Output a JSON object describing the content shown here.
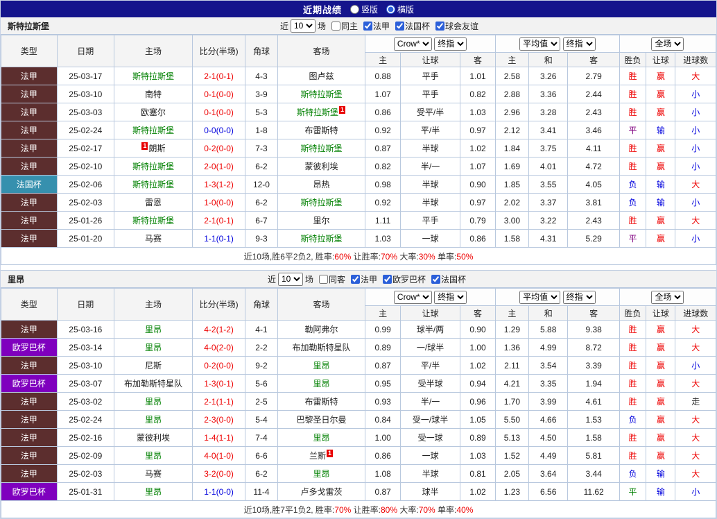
{
  "topbar": {
    "title": "近期战绩",
    "vertical": "竖版",
    "horizontal": "横版",
    "selected": "横版"
  },
  "colors": {
    "navy": "#14148C",
    "border": "#B8C8DE",
    "header_bg": "#F4F4F4",
    "team_focus": "#008000",
    "text": "#222222",
    "codes": {
      "r": "#EE0000",
      "b": "#0000DD",
      "p": "#800080",
      "g": "#008000",
      "k": "#333333"
    },
    "league": {
      "ligue1": "#5C2E2E",
      "coupe": "#3690AE",
      "europa": "#7F00BE"
    }
  },
  "headers": {
    "cols": [
      "类型",
      "日期",
      "主场",
      "比分(半场)",
      "角球",
      "客场"
    ],
    "sub": [
      "主",
      "让球",
      "客",
      "主",
      "和",
      "客",
      "胜负",
      "让球",
      "进球数"
    ]
  },
  "sections": [
    {
      "team": "斯特拉斯堡",
      "filter": {
        "near": "近",
        "count": "10",
        "games": "场",
        "same": "同主",
        "leagues": [
          "法甲",
          "法国杯",
          "球会友谊"
        ]
      },
      "selects": [
        "Crow*",
        "终指",
        "平均值",
        "终指",
        "全场"
      ],
      "rows": [
        {
          "league": "法甲",
          "lc": "ligue1",
          "date": "25-03-17",
          "home": {
            "text": "斯特拉斯堡",
            "focus": true
          },
          "score": "2-1(0-1)",
          "sc": "r",
          "corner": "4-3",
          "away": {
            "text": "图卢兹"
          },
          "odds": [
            "0.88",
            "平手",
            "1.01"
          ],
          "avg": [
            "2.58",
            "3.26",
            "2.79"
          ],
          "res": [
            [
              "胜",
              "r"
            ],
            [
              "赢",
              "r"
            ],
            [
              "大",
              "r"
            ]
          ]
        },
        {
          "league": "法甲",
          "lc": "ligue1",
          "date": "25-03-10",
          "home": {
            "text": "南特"
          },
          "score": "0-1(0-0)",
          "sc": "r",
          "corner": "3-9",
          "away": {
            "text": "斯特拉斯堡",
            "focus": true
          },
          "odds": [
            "1.07",
            "平手",
            "0.82"
          ],
          "avg": [
            "2.88",
            "3.36",
            "2.44"
          ],
          "res": [
            [
              "胜",
              "r"
            ],
            [
              "赢",
              "r"
            ],
            [
              "小",
              "b"
            ]
          ]
        },
        {
          "league": "法甲",
          "lc": "ligue1",
          "date": "25-03-03",
          "home": {
            "text": "欧塞尔"
          },
          "score": "0-1(0-0)",
          "sc": "r",
          "corner": "5-3",
          "away": {
            "text": "斯特拉斯堡",
            "focus": true,
            "badge": "1",
            "badge_pos": "after"
          },
          "odds": [
            "0.86",
            "受平/半",
            "1.03"
          ],
          "avg": [
            "2.96",
            "3.28",
            "2.43"
          ],
          "res": [
            [
              "胜",
              "r"
            ],
            [
              "赢",
              "r"
            ],
            [
              "小",
              "b"
            ]
          ]
        },
        {
          "league": "法甲",
          "lc": "ligue1",
          "date": "25-02-24",
          "home": {
            "text": "斯特拉斯堡",
            "focus": true
          },
          "score": "0-0(0-0)",
          "sc": "b",
          "corner": "1-8",
          "away": {
            "text": "布雷斯特"
          },
          "odds": [
            "0.92",
            "平/半",
            "0.97"
          ],
          "avg": [
            "2.12",
            "3.41",
            "3.46"
          ],
          "res": [
            [
              "平",
              "p"
            ],
            [
              "输",
              "b"
            ],
            [
              "小",
              "b"
            ]
          ]
        },
        {
          "league": "法甲",
          "lc": "ligue1",
          "date": "25-02-17",
          "home": {
            "text": "朗斯",
            "badge": "1",
            "badge_pos": "before"
          },
          "score": "0-2(0-0)",
          "sc": "r",
          "corner": "7-3",
          "away": {
            "text": "斯特拉斯堡",
            "focus": true
          },
          "odds": [
            "0.87",
            "半球",
            "1.02"
          ],
          "avg": [
            "1.84",
            "3.75",
            "4.11"
          ],
          "res": [
            [
              "胜",
              "r"
            ],
            [
              "赢",
              "r"
            ],
            [
              "小",
              "b"
            ]
          ]
        },
        {
          "league": "法甲",
          "lc": "ligue1",
          "date": "25-02-10",
          "home": {
            "text": "斯特拉斯堡",
            "focus": true
          },
          "score": "2-0(1-0)",
          "sc": "r",
          "corner": "6-2",
          "away": {
            "text": "蒙彼利埃"
          },
          "odds": [
            "0.82",
            "半/一",
            "1.07"
          ],
          "avg": [
            "1.69",
            "4.01",
            "4.72"
          ],
          "res": [
            [
              "胜",
              "r"
            ],
            [
              "赢",
              "r"
            ],
            [
              "小",
              "b"
            ]
          ]
        },
        {
          "league": "法国杯",
          "lc": "coupe",
          "date": "25-02-06",
          "home": {
            "text": "斯特拉斯堡",
            "focus": true
          },
          "score": "1-3(1-2)",
          "sc": "r",
          "corner": "12-0",
          "away": {
            "text": "昂热"
          },
          "odds": [
            "0.98",
            "半球",
            "0.90"
          ],
          "avg": [
            "1.85",
            "3.55",
            "4.05"
          ],
          "res": [
            [
              "负",
              "b"
            ],
            [
              "输",
              "b"
            ],
            [
              "大",
              "r"
            ]
          ]
        },
        {
          "league": "法甲",
          "lc": "ligue1",
          "date": "25-02-03",
          "home": {
            "text": "雷恩"
          },
          "score": "1-0(0-0)",
          "sc": "r",
          "corner": "6-2",
          "away": {
            "text": "斯特拉斯堡",
            "focus": true
          },
          "odds": [
            "0.92",
            "半球",
            "0.97"
          ],
          "avg": [
            "2.02",
            "3.37",
            "3.81"
          ],
          "res": [
            [
              "负",
              "b"
            ],
            [
              "输",
              "b"
            ],
            [
              "小",
              "b"
            ]
          ]
        },
        {
          "league": "法甲",
          "lc": "ligue1",
          "date": "25-01-26",
          "home": {
            "text": "斯特拉斯堡",
            "focus": true
          },
          "score": "2-1(0-1)",
          "sc": "r",
          "corner": "6-7",
          "away": {
            "text": "里尔"
          },
          "odds": [
            "1.11",
            "平手",
            "0.79"
          ],
          "avg": [
            "3.00",
            "3.22",
            "2.43"
          ],
          "res": [
            [
              "胜",
              "r"
            ],
            [
              "赢",
              "r"
            ],
            [
              "大",
              "r"
            ]
          ]
        },
        {
          "league": "法甲",
          "lc": "ligue1",
          "date": "25-01-20",
          "home": {
            "text": "马赛"
          },
          "score": "1-1(0-1)",
          "sc": "b",
          "corner": "9-3",
          "away": {
            "text": "斯特拉斯堡",
            "focus": true
          },
          "odds": [
            "1.03",
            "一球",
            "0.86"
          ],
          "avg": [
            "1.58",
            "4.31",
            "5.29"
          ],
          "res": [
            [
              "平",
              "p"
            ],
            [
              "赢",
              "r"
            ],
            [
              "小",
              "b"
            ]
          ]
        }
      ],
      "summary": [
        [
          "近10场,胜6平2负2, 胜率:",
          "k"
        ],
        [
          "60%",
          "r"
        ],
        [
          " 让胜率:",
          "k"
        ],
        [
          "70%",
          "r"
        ],
        [
          " 大率:",
          "k"
        ],
        [
          "30%",
          "r"
        ],
        [
          " 单率:",
          "k"
        ],
        [
          "50%",
          "r"
        ]
      ]
    },
    {
      "team": "里昂",
      "filter": {
        "near": "近",
        "count": "10",
        "games": "场",
        "same": "同客",
        "leagues": [
          "法甲",
          "欧罗巴杯",
          "法国杯"
        ]
      },
      "selects": [
        "Crow*",
        "终指",
        "平均值",
        "终指",
        "全场"
      ],
      "rows": [
        {
          "league": "法甲",
          "lc": "ligue1",
          "date": "25-03-16",
          "home": {
            "text": "里昂",
            "focus": true
          },
          "score": "4-2(1-2)",
          "sc": "r",
          "corner": "4-1",
          "away": {
            "text": "勒阿弗尔"
          },
          "odds": [
            "0.99",
            "球半/两",
            "0.90"
          ],
          "avg": [
            "1.29",
            "5.88",
            "9.38"
          ],
          "res": [
            [
              "胜",
              "r"
            ],
            [
              "赢",
              "r"
            ],
            [
              "大",
              "r"
            ]
          ]
        },
        {
          "league": "欧罗巴杯",
          "lc": "europa",
          "date": "25-03-14",
          "home": {
            "text": "里昂",
            "focus": true
          },
          "score": "4-0(2-0)",
          "sc": "r",
          "corner": "2-2",
          "away": {
            "text": "布加勒斯特星队"
          },
          "odds": [
            "0.89",
            "一/球半",
            "1.00"
          ],
          "avg": [
            "1.36",
            "4.99",
            "8.72"
          ],
          "res": [
            [
              "胜",
              "r"
            ],
            [
              "赢",
              "r"
            ],
            [
              "大",
              "r"
            ]
          ]
        },
        {
          "league": "法甲",
          "lc": "ligue1",
          "date": "25-03-10",
          "home": {
            "text": "尼斯"
          },
          "score": "0-2(0-0)",
          "sc": "r",
          "corner": "9-2",
          "away": {
            "text": "里昂",
            "focus": true
          },
          "odds": [
            "0.87",
            "平/半",
            "1.02"
          ],
          "avg": [
            "2.11",
            "3.54",
            "3.39"
          ],
          "res": [
            [
              "胜",
              "r"
            ],
            [
              "赢",
              "r"
            ],
            [
              "小",
              "b"
            ]
          ]
        },
        {
          "league": "欧罗巴杯",
          "lc": "europa",
          "date": "25-03-07",
          "home": {
            "text": "布加勒斯特星队"
          },
          "score": "1-3(0-1)",
          "sc": "r",
          "corner": "5-6",
          "away": {
            "text": "里昂",
            "focus": true
          },
          "odds": [
            "0.95",
            "受半球",
            "0.94"
          ],
          "avg": [
            "4.21",
            "3.35",
            "1.94"
          ],
          "res": [
            [
              "胜",
              "r"
            ],
            [
              "赢",
              "r"
            ],
            [
              "大",
              "r"
            ]
          ]
        },
        {
          "league": "法甲",
          "lc": "ligue1",
          "date": "25-03-02",
          "home": {
            "text": "里昂",
            "focus": true
          },
          "score": "2-1(1-1)",
          "sc": "r",
          "corner": "2-5",
          "away": {
            "text": "布雷斯特"
          },
          "odds": [
            "0.93",
            "半/一",
            "0.96"
          ],
          "avg": [
            "1.70",
            "3.99",
            "4.61"
          ],
          "res": [
            [
              "胜",
              "r"
            ],
            [
              "赢",
              "r"
            ],
            [
              "走",
              "k"
            ]
          ]
        },
        {
          "league": "法甲",
          "lc": "ligue1",
          "date": "25-02-24",
          "home": {
            "text": "里昂",
            "focus": true
          },
          "score": "2-3(0-0)",
          "sc": "r",
          "corner": "5-4",
          "away": {
            "text": "巴黎圣日尔曼"
          },
          "odds": [
            "0.84",
            "受一/球半",
            "1.05"
          ],
          "avg": [
            "5.50",
            "4.66",
            "1.53"
          ],
          "res": [
            [
              "负",
              "b"
            ],
            [
              "赢",
              "r"
            ],
            [
              "大",
              "r"
            ]
          ]
        },
        {
          "league": "法甲",
          "lc": "ligue1",
          "date": "25-02-16",
          "home": {
            "text": "蒙彼利埃"
          },
          "score": "1-4(1-1)",
          "sc": "r",
          "corner": "7-4",
          "away": {
            "text": "里昂",
            "focus": true
          },
          "odds": [
            "1.00",
            "受一球",
            "0.89"
          ],
          "avg": [
            "5.13",
            "4.50",
            "1.58"
          ],
          "res": [
            [
              "胜",
              "r"
            ],
            [
              "赢",
              "r"
            ],
            [
              "大",
              "r"
            ]
          ]
        },
        {
          "league": "法甲",
          "lc": "ligue1",
          "date": "25-02-09",
          "home": {
            "text": "里昂",
            "focus": true
          },
          "score": "4-0(1-0)",
          "sc": "r",
          "corner": "6-6",
          "away": {
            "text": "兰斯",
            "badge": "1",
            "badge_pos": "after"
          },
          "odds": [
            "0.86",
            "一球",
            "1.03"
          ],
          "avg": [
            "1.52",
            "4.49",
            "5.81"
          ],
          "res": [
            [
              "胜",
              "r"
            ],
            [
              "赢",
              "r"
            ],
            [
              "大",
              "r"
            ]
          ]
        },
        {
          "league": "法甲",
          "lc": "ligue1",
          "date": "25-02-03",
          "home": {
            "text": "马赛"
          },
          "score": "3-2(0-0)",
          "sc": "r",
          "corner": "6-2",
          "away": {
            "text": "里昂",
            "focus": true
          },
          "odds": [
            "1.08",
            "半球",
            "0.81"
          ],
          "avg": [
            "2.05",
            "3.64",
            "3.44"
          ],
          "res": [
            [
              "负",
              "b"
            ],
            [
              "输",
              "b"
            ],
            [
              "大",
              "r"
            ]
          ]
        },
        {
          "league": "欧罗巴杯",
          "lc": "europa",
          "date": "25-01-31",
          "home": {
            "text": "里昂",
            "focus": true
          },
          "score": "1-1(0-0)",
          "sc": "b",
          "corner": "11-4",
          "away": {
            "text": "卢多戈雷茨"
          },
          "odds": [
            "0.87",
            "球半",
            "1.02"
          ],
          "avg": [
            "1.23",
            "6.56",
            "11.62"
          ],
          "res": [
            [
              "平",
              "g"
            ],
            [
              "输",
              "b"
            ],
            [
              "小",
              "b"
            ]
          ]
        }
      ],
      "summary": [
        [
          "近10场,胜7平1负2, 胜率:",
          "k"
        ],
        [
          "70%",
          "r"
        ],
        [
          " 让胜率:",
          "k"
        ],
        [
          "80%",
          "r"
        ],
        [
          " 大率:",
          "k"
        ],
        [
          "70%",
          "r"
        ],
        [
          " 单率:",
          "k"
        ],
        [
          "40%",
          "r"
        ]
      ]
    }
  ]
}
